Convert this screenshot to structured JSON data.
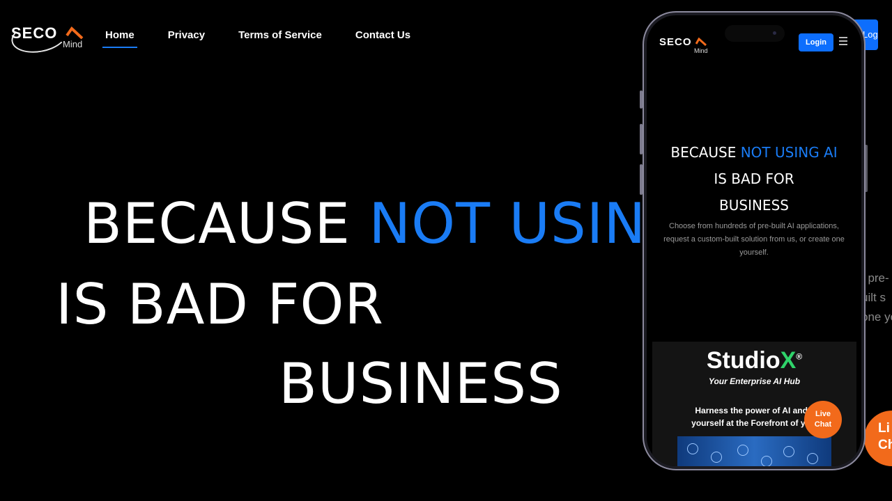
{
  "header": {
    "logo": {
      "brand": "SECO",
      "sub": "Mind"
    },
    "nav": [
      {
        "label": "Home",
        "active": true
      },
      {
        "label": "Privacy",
        "active": false
      },
      {
        "label": "Terms of Service",
        "active": false
      },
      {
        "label": "Contact Us",
        "active": false
      }
    ],
    "login_label": "Login"
  },
  "hero": {
    "line1_prefix": "BECAUSE ",
    "line1_accent": "NOT USING",
    "line2": "IS BAD FOR",
    "line3": "BUSINESS",
    "description_lines": [
      "f pre-",
      "uilt s",
      "one yo"
    ]
  },
  "live_chat": {
    "line1": "Li",
    "line2": "Ch"
  },
  "phone": {
    "logo": {
      "brand": "SECO",
      "sub": "Mind"
    },
    "login_label": "Login",
    "hero": {
      "line1_prefix": "BECAUSE ",
      "line1_accent": "NOT USING AI",
      "line2": "IS BAD FOR",
      "line3": "BUSINESS"
    },
    "description": "Choose from hundreds of pre-built AI applications, request a custom-built solution from us, or create one yourself.",
    "studio": {
      "name_prefix": "Studio",
      "name_accent": "X",
      "trademark": "®",
      "tagline": "Your Enterprise AI Hub",
      "harness_line1": "Harness the power of AI and p",
      "harness_line2": "yourself at the Forefront of your"
    },
    "live_chat": {
      "line1": "Live",
      "line2": "Chat"
    }
  },
  "colors": {
    "accent": "#1a7cf5",
    "login_bg": "#0d6efd",
    "chat_bg": "#f26a1b",
    "studio_x": "#2fd36a"
  }
}
